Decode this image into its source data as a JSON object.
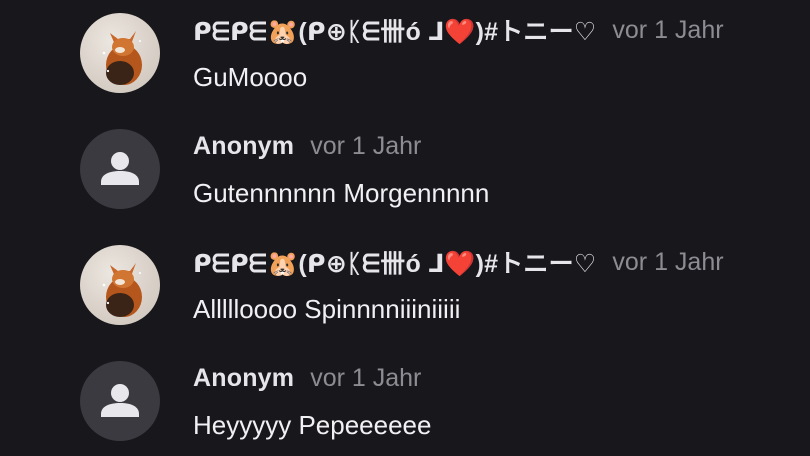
{
  "comments": [
    {
      "author": "ᑭᗴᑭᗴ🐹(ᑭ⊕ᛕᗴ卌ó ⅃❤️)#トニー♡",
      "time": "vor 1 Jahr",
      "text": "GuMoooo",
      "avatar_type": "photo"
    },
    {
      "author": "Anonym",
      "time": "vor 1 Jahr",
      "text": "Gutennnnnn Morgennnnn",
      "avatar_type": "anonymous"
    },
    {
      "author": "ᑭᗴᑭᗴ🐹(ᑭ⊕ᛕᗴ卌ó ⅃❤️)#トニー♡",
      "time": "vor 1 Jahr",
      "text": "Allllloooo Spinnnniiiniiiii",
      "avatar_type": "photo"
    },
    {
      "author": "Anonym",
      "time": "vor 1 Jahr",
      "text": "Heyyyyy Pepeeeeee",
      "avatar_type": "anonymous"
    }
  ],
  "colors": {
    "background": "#17171c",
    "author_text": "#e6e6ea",
    "time_text": "#8c8c92",
    "body_text": "#f1f1f4",
    "anon_avatar_bg": "#3a3a40",
    "anon_icon": "#e8e8ec"
  },
  "icons": {
    "anonymous_avatar": "person-icon",
    "photo_avatar": "fox-photo-avatar"
  }
}
